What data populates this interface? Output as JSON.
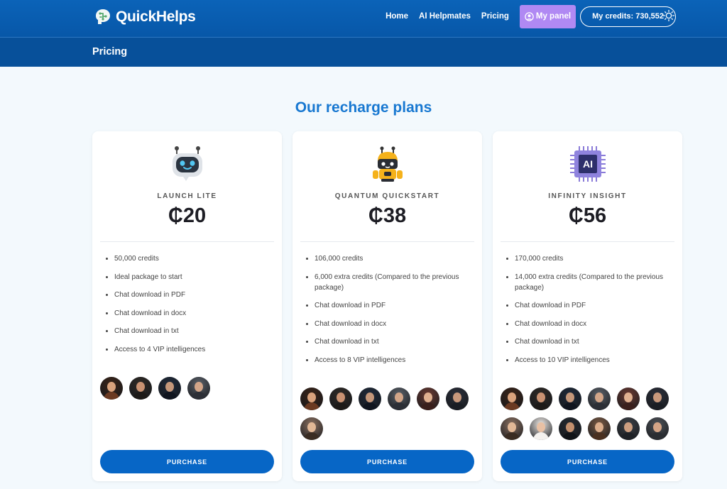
{
  "header": {
    "brand": "QuickHelps",
    "nav": [
      "Home",
      "AI Helpmates",
      "Pricing"
    ],
    "panel_label": "My panel",
    "credits_label": "My credits: 730,552"
  },
  "subheader": {
    "title": "Pricing"
  },
  "section_title": "Our recharge plans",
  "plans": [
    {
      "name": "LAUNCH LITE",
      "price": "₵20",
      "features": [
        "50,000 credits",
        "Ideal package to start",
        "Chat download in PDF",
        "Chat download in docx",
        "Chat download in txt",
        "Access to 4 VIP intelligences"
      ],
      "avatar_count": 4,
      "button": "PURCHASE"
    },
    {
      "name": "QUANTUM QUICKSTART",
      "price": "₵38",
      "features": [
        "106,000 credits",
        "6,000 extra credits (Compared to the previous package)",
        "Chat download in PDF",
        "Chat download in docx",
        "Chat download in txt",
        "Access to 8 VIP intelligences"
      ],
      "avatar_count": 7,
      "button": "PURCHASE"
    },
    {
      "name": "INFINITY INSIGHT",
      "price": "₵56",
      "features": [
        "170,000 credits",
        "14,000 extra credits (Compared to the previous package)",
        "Chat download in PDF",
        "Chat download in docx",
        "Chat download in txt",
        "Access to 10 VIP intelligences"
      ],
      "avatar_count": 12,
      "button": "PURCHASE"
    }
  ],
  "plan_icons": [
    "robot-head-icon",
    "yellow-robot-icon",
    "ai-chip-icon"
  ],
  "icon_text": {
    "ai_chip": "AI"
  },
  "colors": {
    "header": "#0b63b8",
    "subheader": "#07509a",
    "accent": "#1878d1",
    "button": "#0766c6",
    "panel": "#b089f3"
  }
}
